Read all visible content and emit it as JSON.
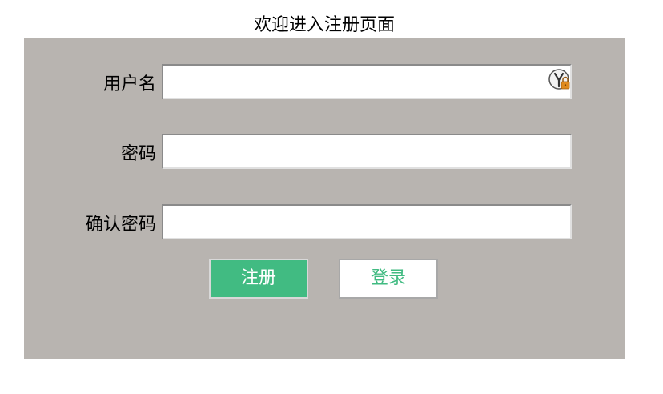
{
  "page": {
    "title": "欢迎进入注册页面"
  },
  "form": {
    "username_label": "用户名",
    "username_value": "",
    "password_label": "密码",
    "password_value": "",
    "confirm_label": "确认密码",
    "confirm_value": "",
    "register_label": "注册",
    "login_label": "登录",
    "password_manager_icon": "key-lock-icon"
  },
  "colors": {
    "panel": "#b8b4b0",
    "accent": "#41bb82",
    "background": "#ffffff"
  }
}
